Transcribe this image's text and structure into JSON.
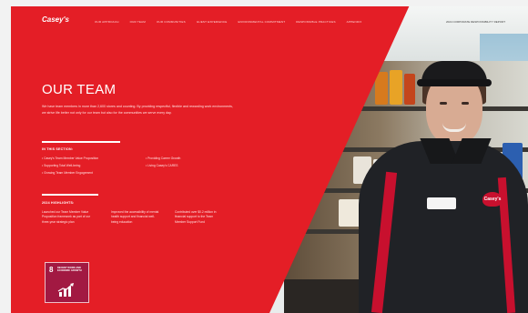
{
  "header": {
    "logo": "Casey's",
    "nav": [
      "OUR APPROACH",
      "OUR TEAM",
      "OUR COMMUNITIES",
      "GUEST EXPERIENCE",
      "ENVIRONMENTAL COMMITMENT",
      "RESPONSIBLE PRACTICES",
      "APPENDIX"
    ],
    "right": "2024 CORPORATE RESPONSIBILITY REPORT"
  },
  "main": {
    "title": "OUR TEAM",
    "intro": "We have team members in more than 2,600 stores and counting. By providing respectful, flexible and rewarding work environments, we strive life better not only for our team but also for the communities we serve every day.",
    "section_heading": "IN THIS SECTION:",
    "section_items_left": [
      "Casey's Team Member Value Proposition",
      "Supporting Total Well-being",
      "Growing Team Member Engagement"
    ],
    "section_items_right": [
      "Providing Career Growth",
      "Living Casey's CARES"
    ],
    "highlights_heading": "2024 HIGHLIGHTS:",
    "highlights": [
      "Launched our Team Member Value Proposition framework as part of our three-year strategic plan",
      "Improved the accessibility of mental health support and financial well-being education",
      "Contributed over $0.2 million in financial support to the Team Member Support Fund"
    ]
  },
  "sdg": {
    "number": "8",
    "label": "DECENT WORK AND ECONOMIC GROWTH",
    "color": "#a21942"
  },
  "photo": {
    "patch_text": "Casey's"
  },
  "colors": {
    "brand_red": "#e41e26"
  }
}
